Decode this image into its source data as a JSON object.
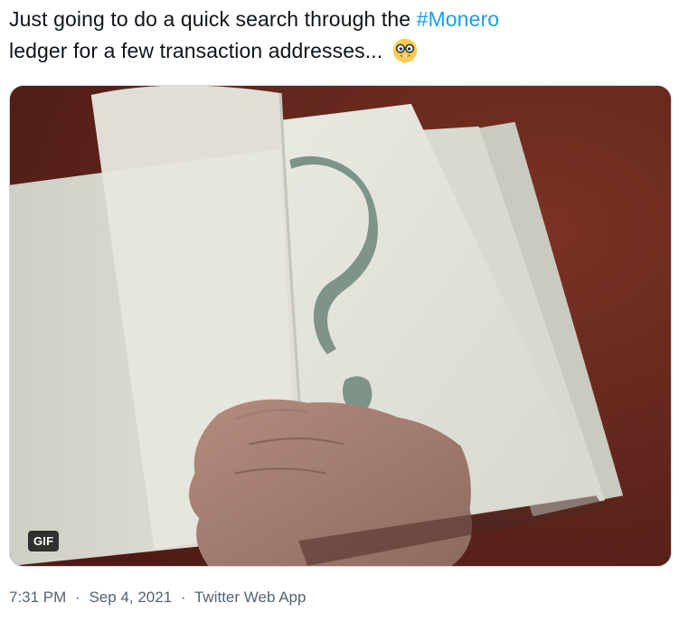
{
  "tweet": {
    "text_part1": "Just going to do a quick search through the ",
    "hashtag": "#Monero",
    "text_part2": "ledger for a few transaction addresses... ",
    "emoji": "nerd-face-icon"
  },
  "media": {
    "badge": "GIF",
    "content": "hand flipping pages of a book showing a question mark"
  },
  "meta": {
    "time": "7:31 PM",
    "date": "Sep 4, 2021",
    "separator": "·",
    "source": "Twitter Web App"
  },
  "colors": {
    "text": "#0f1419",
    "link": "#1d9bf0",
    "secondary": "#536471",
    "border": "#cfd9de"
  }
}
